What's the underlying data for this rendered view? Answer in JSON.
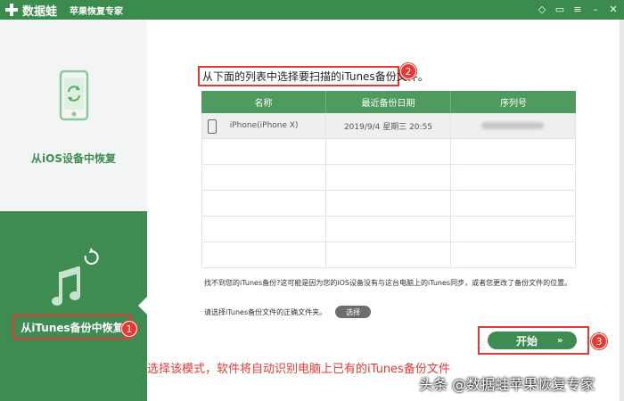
{
  "titlebar": {
    "app_name": "数据蛙",
    "app_subtitle": "苹果恢复专家",
    "icons": [
      "diamond-icon",
      "chat-icon",
      "menu-icon",
      "minimize-icon",
      "close-icon"
    ],
    "glyphs": {
      "diamond": "◇",
      "chat": "▭",
      "menu": "≡",
      "minimize": "–",
      "close": "✕"
    }
  },
  "sidebar": {
    "ios_label": "从iOS设备中恢复",
    "itunes_label": "从iTunes备份中恢复"
  },
  "main": {
    "instruction": "从下面的列表中选择要扫描的iTunes备份文件。",
    "table": {
      "headers": [
        "名称",
        "最近备份日期",
        "序列号"
      ],
      "rows": [
        {
          "name": "iPhone(iPhone X)",
          "date": "2019/9/4 星期三 20:55",
          "serial": ""
        }
      ],
      "empty_rows": 5
    },
    "note": "找不到您的iTunes备份?这可能是因为您的iOS设备没有与这台电脑上的iTunes同步，或者您更改了备份文件的位置。",
    "select_prompt": "请选择iTunes备份文件的正确文件夹。",
    "select_button": "选择",
    "start_button": "开始",
    "start_arrows": "»"
  },
  "annotations": {
    "badges": [
      "1",
      "2",
      "3"
    ],
    "caption": "选择该模式，软件将自动识别电脑上已有的iTunes备份文件",
    "watermark": "头条 @数据蛙苹果恢复专家"
  },
  "colors": {
    "brand_green": "#3f8c53",
    "header_green": "#4e9a5f",
    "annotation_red": "#e53935"
  }
}
